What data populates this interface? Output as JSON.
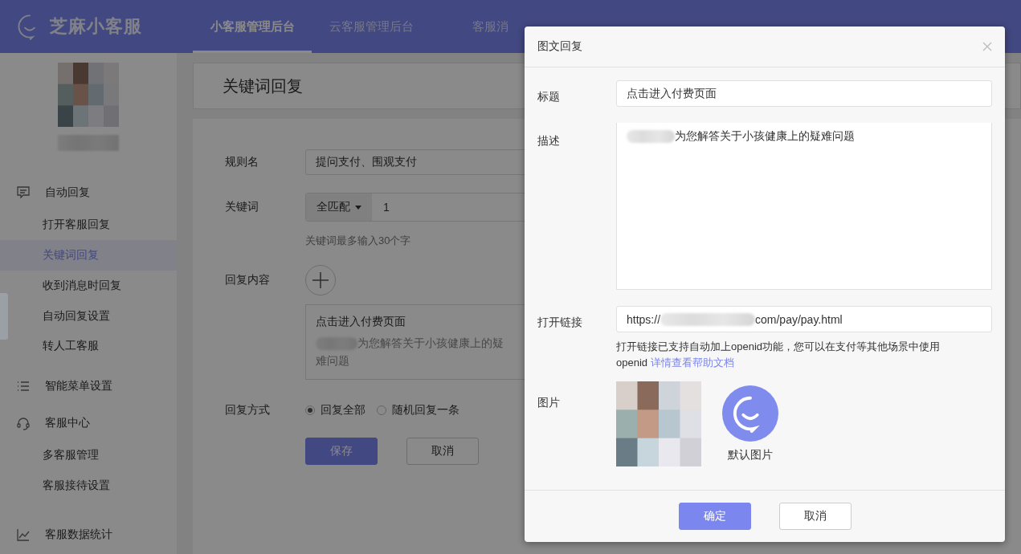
{
  "header": {
    "logo_text": "芝麻小客服",
    "nav": [
      {
        "label": "小客服管理后台",
        "selected": true
      },
      {
        "label": "云客服管理后台",
        "selected": false
      },
      {
        "label": "客服消",
        "selected": false
      }
    ]
  },
  "sidebar": {
    "groups": [
      {
        "label": "自动回复",
        "children": [
          {
            "label": "打开客服回复",
            "selected": false
          },
          {
            "label": "关键词回复",
            "selected": true
          },
          {
            "label": "收到消息时回复",
            "selected": false
          },
          {
            "label": "自动回复设置",
            "selected": false
          },
          {
            "label": "转人工客服",
            "selected": false
          }
        ]
      },
      {
        "label": "智能菜单设置"
      },
      {
        "label": "客服中心",
        "children": [
          {
            "label": "多客服管理",
            "selected": false
          },
          {
            "label": "客服接待设置",
            "selected": false
          }
        ]
      },
      {
        "label": "客服数据统计"
      }
    ]
  },
  "page": {
    "title": "关键词回复",
    "rule_name": {
      "label": "规则名",
      "value": "提问支付、围观支付"
    },
    "keyword": {
      "label": "关键词",
      "match": "全匹配",
      "value": "1",
      "hint": "关键词最多输入30个字"
    },
    "reply_content": {
      "label": "回复内容",
      "card_title": "点击进入付费页面",
      "card_text": "为您解答关于小孩健康上的疑难问题"
    },
    "reply_mode": {
      "label": "回复方式",
      "options": [
        {
          "label": "回复全部",
          "selected": true
        },
        {
          "label": "随机回复一条",
          "selected": false
        }
      ]
    },
    "buttons": [
      {
        "label": "保存",
        "kind": "primary"
      },
      {
        "label": "取消",
        "kind": "default"
      }
    ]
  },
  "modal": {
    "title": "图文回复",
    "title_field": {
      "label": "标题",
      "value": "点击进入付费页面"
    },
    "description": {
      "label": "描述",
      "value": "为您解答关于小孩健康上的疑难问题"
    },
    "link": {
      "label": "打开链接",
      "url_start": "https://",
      "url_end": "com/pay/pay.html",
      "hint": "打开链接已支持自动加上openid功能，您可以在支付等其他场景中使用openid ",
      "help_link": "详情查看帮助文档"
    },
    "image": {
      "label": "图片",
      "default_caption": "默认图片"
    },
    "buttons": [
      {
        "label": "确定",
        "kind": "primary"
      },
      {
        "label": "取消",
        "kind": "default"
      }
    ]
  }
}
